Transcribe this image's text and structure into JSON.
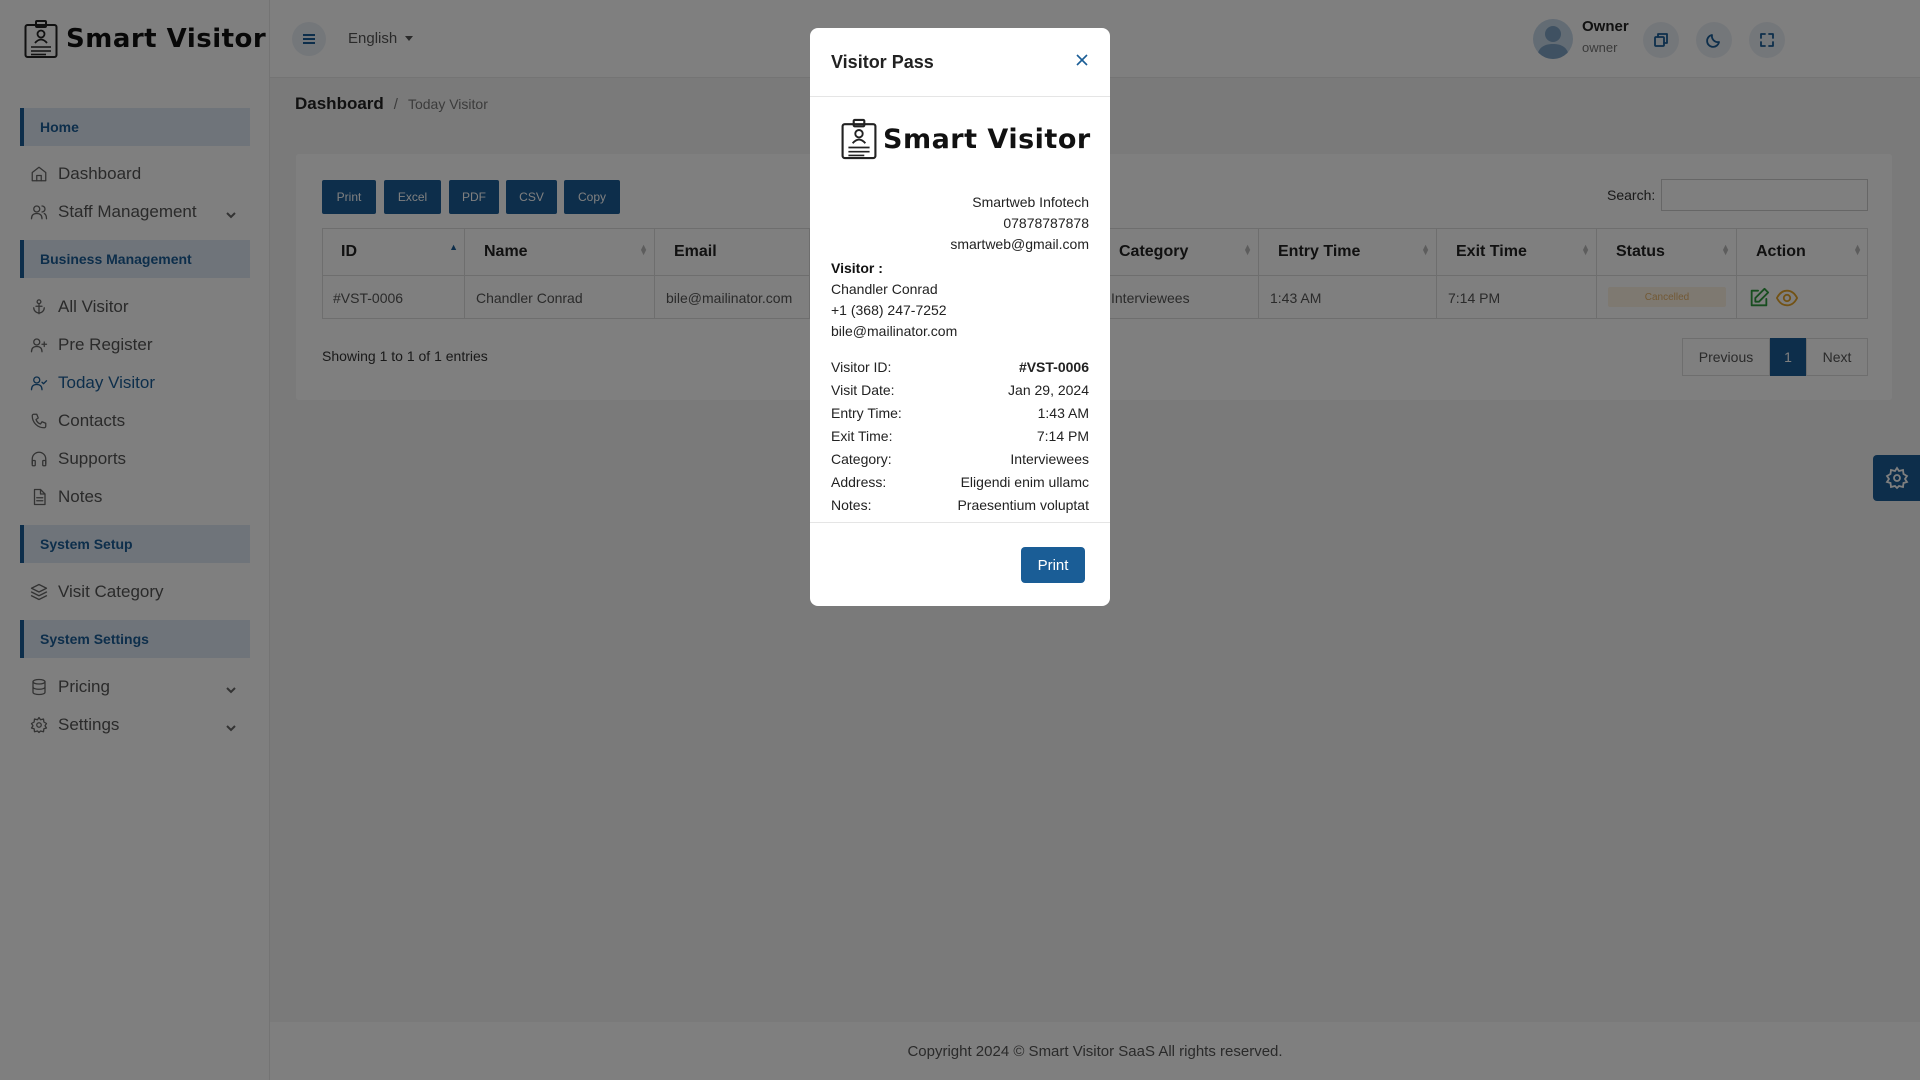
{
  "app": {
    "logo_text": "Smart Visitor"
  },
  "sidebar": {
    "sections": [
      "Home",
      "Business Management",
      "System Setup",
      "System Settings"
    ],
    "items": [
      {
        "label": "Dashboard",
        "icon": "home-icon"
      },
      {
        "label": "Staff Management",
        "icon": "users-icon"
      },
      {
        "label": "All Visitor",
        "icon": "anchor-icon"
      },
      {
        "label": "Pre Register",
        "icon": "user-plus-icon"
      },
      {
        "label": "Today Visitor",
        "icon": "user-check-icon"
      },
      {
        "label": "Contacts",
        "icon": "phone-icon"
      },
      {
        "label": "Supports",
        "icon": "headphones-icon"
      },
      {
        "label": "Notes",
        "icon": "file-text-icon"
      },
      {
        "label": "Visit Category",
        "icon": "layers-icon"
      },
      {
        "label": "Pricing",
        "icon": "database-icon"
      },
      {
        "label": "Settings",
        "icon": "gear-icon"
      }
    ]
  },
  "topbar": {
    "language": "English",
    "user_name": "Owner",
    "user_role": "owner"
  },
  "breadcrumb": {
    "main": "Dashboard",
    "separator": "/",
    "current": "Today Visitor"
  },
  "toolbar": {
    "buttons": [
      "Print",
      "Excel",
      "PDF",
      "CSV",
      "Copy"
    ],
    "search_label": "Search:"
  },
  "table": {
    "columns": [
      "ID",
      "Name",
      "Email",
      "Category",
      "Entry Time",
      "Exit Time",
      "Status",
      "Action"
    ],
    "rows": [
      {
        "id": "#VST-0006",
        "name": "Chandler Conrad",
        "email": "bile@mailinator.com",
        "category": "Interviewees",
        "entry_time": "1:43 AM",
        "exit_time": "7:14 PM",
        "status": "Cancelled"
      }
    ]
  },
  "pagination": {
    "showing_text": "Showing 1 to 1 of 1 entries",
    "previous": "Previous",
    "current_page": "1",
    "next": "Next"
  },
  "footer": {
    "copyright": "Copyright 2024 © Smart Visitor SaaS All rights reserved."
  },
  "modal": {
    "title": "Visitor Pass",
    "company_name": "Smartweb Infotech",
    "company_phone": "07878787878",
    "company_email": "smartweb@gmail.com",
    "visitor_heading": "Visitor :",
    "visitor_name": "Chandler Conrad",
    "visitor_phone": "+1 (368) 247-7252",
    "visitor_email": "bile@mailinator.com",
    "details": [
      {
        "label": "Visitor ID:",
        "value": "#VST-0006"
      },
      {
        "label": "Visit Date:",
        "value": "Jan 29, 2024"
      },
      {
        "label": "Entry Time:",
        "value": "1:43 AM"
      },
      {
        "label": "Exit Time:",
        "value": "7:14 PM"
      },
      {
        "label": "Category:",
        "value": "Interviewees"
      },
      {
        "label": "Address:",
        "value": "Eligendi enim ullamc"
      },
      {
        "label": "Notes:",
        "value": "Praesentium voluptat"
      }
    ],
    "print_button": "Print"
  },
  "colors": {
    "primary": "#1a5d96",
    "section_bg": "#dfe9f5",
    "status_cancelled_bg": "#fdf3e2",
    "status_cancelled_text": "#e5b26b",
    "edit_icon": "#2e9a3e",
    "view_icon": "#e5a52b"
  }
}
